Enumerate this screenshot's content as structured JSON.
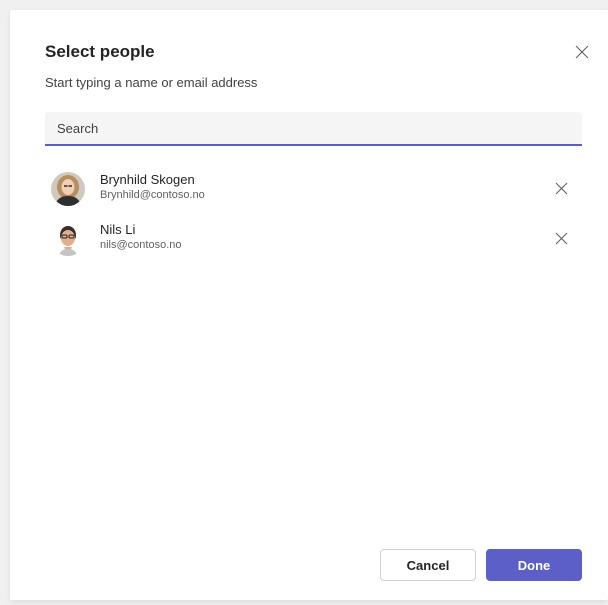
{
  "dialog": {
    "title": "Select people",
    "subtitle": "Start typing a name or email address",
    "search_placeholder": "Search",
    "close_icon": "close-icon",
    "accent_color": "#5b5fc7"
  },
  "people": [
    {
      "name": "Brynhild Skogen",
      "email": "Brynhild@contoso.no",
      "remove_icon": "close-icon"
    },
    {
      "name": "Nils Li",
      "email": "nils@contoso.no",
      "remove_icon": "close-icon"
    }
  ],
  "footer": {
    "cancel_label": "Cancel",
    "done_label": "Done"
  }
}
